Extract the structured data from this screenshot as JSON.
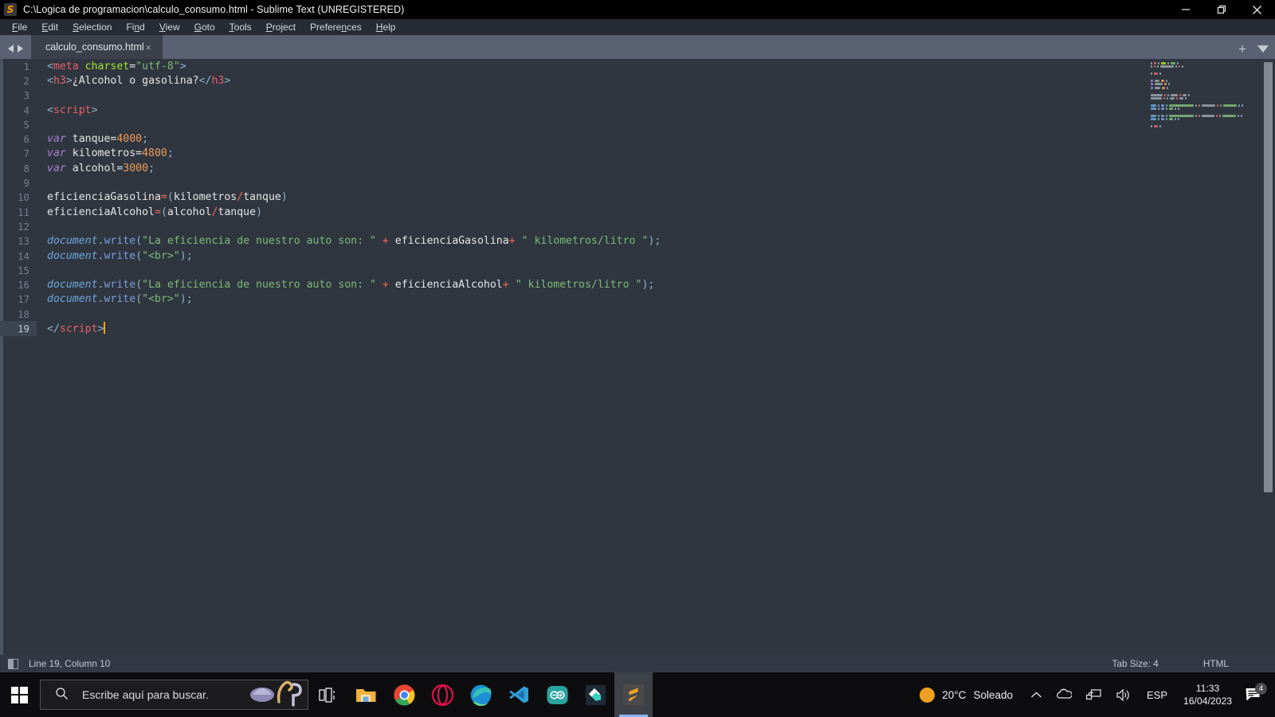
{
  "window": {
    "title": "C:\\Logica de programacion\\calculo_consumo.html - Sublime Text (UNREGISTERED)",
    "app_icon": "sublime-text-icon",
    "minimize_label": "—",
    "maximize_label": "❐",
    "close_label": "✕"
  },
  "menubar": {
    "items": [
      {
        "label": "File"
      },
      {
        "label": "Edit"
      },
      {
        "label": "Selection"
      },
      {
        "label": "Find"
      },
      {
        "label": "View"
      },
      {
        "label": "Goto"
      },
      {
        "label": "Tools"
      },
      {
        "label": "Project"
      },
      {
        "label": "Preferences"
      },
      {
        "label": "Help"
      }
    ]
  },
  "tabbar": {
    "tabs": [
      {
        "label": "calculo_consumo.html",
        "close": "×",
        "active": true
      }
    ],
    "new_tab": "+",
    "tab_menu": "▼"
  },
  "editor": {
    "lines": [
      {
        "n": "1",
        "tokens": [
          {
            "t": "punc",
            "v": "<"
          },
          {
            "t": "tag",
            "v": "meta"
          },
          {
            "t": "plain",
            "v": " "
          },
          {
            "t": "attr",
            "v": "charset"
          },
          {
            "t": "plain",
            "v": "="
          },
          {
            "t": "str",
            "v": "\"utf-8\""
          },
          {
            "t": "punc",
            "v": ">"
          }
        ]
      },
      {
        "n": "2",
        "tokens": [
          {
            "t": "punc",
            "v": "<"
          },
          {
            "t": "tag",
            "v": "h3"
          },
          {
            "t": "punc",
            "v": ">"
          },
          {
            "t": "plain",
            "v": "¿Alcohol o gasolina?"
          },
          {
            "t": "punc",
            "v": "</"
          },
          {
            "t": "tag",
            "v": "h3"
          },
          {
            "t": "punc",
            "v": ">"
          }
        ]
      },
      {
        "n": "3",
        "tokens": []
      },
      {
        "n": "4",
        "tokens": [
          {
            "t": "punc",
            "v": "<"
          },
          {
            "t": "tag",
            "v": "script"
          },
          {
            "t": "punc",
            "v": ">"
          }
        ]
      },
      {
        "n": "5",
        "tokens": []
      },
      {
        "n": "6",
        "tokens": [
          {
            "t": "kw",
            "v": "var"
          },
          {
            "t": "plain",
            "v": " tanque="
          },
          {
            "t": "num",
            "v": "4000"
          },
          {
            "t": "punc",
            "v": ";"
          }
        ]
      },
      {
        "n": "7",
        "tokens": [
          {
            "t": "kw",
            "v": "var"
          },
          {
            "t": "plain",
            "v": " kilometros="
          },
          {
            "t": "num",
            "v": "4800"
          },
          {
            "t": "punc",
            "v": ";"
          }
        ]
      },
      {
        "n": "8",
        "tokens": [
          {
            "t": "kw",
            "v": "var"
          },
          {
            "t": "plain",
            "v": " alcohol="
          },
          {
            "t": "num",
            "v": "3000"
          },
          {
            "t": "punc",
            "v": ";"
          }
        ]
      },
      {
        "n": "9",
        "tokens": []
      },
      {
        "n": "10",
        "tokens": [
          {
            "t": "plain",
            "v": "eficienciaGasolina"
          },
          {
            "t": "op",
            "v": "="
          },
          {
            "t": "paren",
            "v": "("
          },
          {
            "t": "plain",
            "v": "kilometros"
          },
          {
            "t": "op",
            "v": "/"
          },
          {
            "t": "plain",
            "v": "tanque"
          },
          {
            "t": "paren",
            "v": ")"
          }
        ]
      },
      {
        "n": "11",
        "tokens": [
          {
            "t": "plain",
            "v": "eficienciaAlcohol"
          },
          {
            "t": "op",
            "v": "="
          },
          {
            "t": "paren",
            "v": "("
          },
          {
            "t": "plain",
            "v": "alcohol"
          },
          {
            "t": "op",
            "v": "/"
          },
          {
            "t": "plain",
            "v": "tanque"
          },
          {
            "t": "paren",
            "v": ")"
          }
        ]
      },
      {
        "n": "12",
        "tokens": []
      },
      {
        "n": "13",
        "tokens": [
          {
            "t": "obj",
            "v": "document"
          },
          {
            "t": "punc",
            "v": "."
          },
          {
            "t": "fn",
            "v": "write"
          },
          {
            "t": "paren",
            "v": "("
          },
          {
            "t": "str",
            "v": "\"La eficiencia de nuestro auto son: \""
          },
          {
            "t": "plain",
            "v": " "
          },
          {
            "t": "op",
            "v": "+"
          },
          {
            "t": "plain",
            "v": " eficienciaGasolina"
          },
          {
            "t": "op",
            "v": "+"
          },
          {
            "t": "plain",
            "v": " "
          },
          {
            "t": "str",
            "v": "\" kilometros/litro \""
          },
          {
            "t": "paren",
            "v": ")"
          },
          {
            "t": "punc",
            "v": ";"
          }
        ]
      },
      {
        "n": "14",
        "tokens": [
          {
            "t": "obj",
            "v": "document"
          },
          {
            "t": "punc",
            "v": "."
          },
          {
            "t": "fn",
            "v": "write"
          },
          {
            "t": "paren",
            "v": "("
          },
          {
            "t": "str",
            "v": "\"<br>\""
          },
          {
            "t": "paren",
            "v": ")"
          },
          {
            "t": "punc",
            "v": ";"
          }
        ]
      },
      {
        "n": "15",
        "tokens": []
      },
      {
        "n": "16",
        "tokens": [
          {
            "t": "obj",
            "v": "document"
          },
          {
            "t": "punc",
            "v": "."
          },
          {
            "t": "fn",
            "v": "write"
          },
          {
            "t": "paren",
            "v": "("
          },
          {
            "t": "str",
            "v": "\"La eficiencia de nuestro auto son: \""
          },
          {
            "t": "plain",
            "v": " "
          },
          {
            "t": "op",
            "v": "+"
          },
          {
            "t": "plain",
            "v": " eficienciaAlcohol"
          },
          {
            "t": "op",
            "v": "+"
          },
          {
            "t": "plain",
            "v": " "
          },
          {
            "t": "str",
            "v": "\" kilometros/litro \""
          },
          {
            "t": "paren",
            "v": ")"
          },
          {
            "t": "punc",
            "v": ";"
          }
        ]
      },
      {
        "n": "17",
        "tokens": [
          {
            "t": "obj",
            "v": "document"
          },
          {
            "t": "punc",
            "v": "."
          },
          {
            "t": "fn",
            "v": "write"
          },
          {
            "t": "paren",
            "v": "("
          },
          {
            "t": "str",
            "v": "\"<br>\""
          },
          {
            "t": "paren",
            "v": ")"
          },
          {
            "t": "punc",
            "v": ";"
          }
        ]
      },
      {
        "n": "18",
        "tokens": []
      },
      {
        "n": "19",
        "tokens": [
          {
            "t": "punc",
            "v": "</"
          },
          {
            "t": "tag",
            "v": "script"
          },
          {
            "t": "punc",
            "v": ">"
          }
        ],
        "active": true,
        "caret": true
      }
    ]
  },
  "statusbar": {
    "cursor_position": "Line 19, Column 10",
    "tab_size": "Tab Size: 4",
    "syntax": "HTML"
  },
  "taskbar": {
    "start_label": "start-button",
    "search_placeholder": "Escribe aquí para buscar.",
    "items": [
      {
        "name": "task-view",
        "label": "Task View"
      },
      {
        "name": "file-explorer",
        "label": "Explorador de archivos"
      },
      {
        "name": "google-chrome",
        "label": "Google Chrome"
      },
      {
        "name": "opera-browser",
        "label": "Opera"
      },
      {
        "name": "microsoft-edge",
        "label": "Microsoft Edge"
      },
      {
        "name": "visual-studio-code",
        "label": "Visual Studio Code"
      },
      {
        "name": "arduino-ide",
        "label": "Arduino IDE"
      },
      {
        "name": "filmora-editor",
        "label": "Filmora"
      },
      {
        "name": "sublime-text",
        "label": "Sublime Text"
      }
    ],
    "tray": {
      "temperature": "20°C",
      "condition": "Soleado",
      "show_hidden": "∧",
      "language": "ESP",
      "time": "11:33",
      "date": "16/04/2023",
      "notification_count": "4"
    }
  },
  "colors": {
    "editor_bg": "#2f3640",
    "gutter_accent": "#4a5562",
    "tabbar_bg": "#5a6172",
    "active_tab": "#3b404b",
    "statusbar_bg": "#323945",
    "caret": "#f5a623",
    "taskbar_bg": "#0d0d0f",
    "string": "#7fba78",
    "number": "#f29b54",
    "keyword": "#ad7fd0",
    "tag": "#e8606b"
  }
}
